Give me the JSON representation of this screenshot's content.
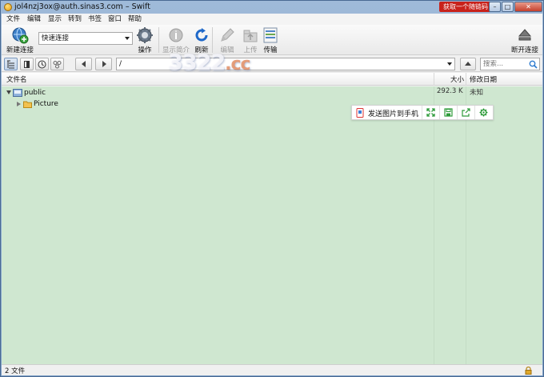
{
  "window": {
    "title": "jol4nzj3ox@auth.sinas3.com – Swift",
    "promo_badge": "获取一个随链码！",
    "controls": {
      "minimize": "–",
      "maximize": "□",
      "close": "✕"
    }
  },
  "menu": [
    "文件",
    "编辑",
    "显示",
    "转到",
    "书签",
    "窗口",
    "帮助"
  ],
  "toolbar": {
    "new_connection": "新建连接",
    "quick_connect_value": "快速连接",
    "action": "操作",
    "info": "显示简介",
    "refresh": "刷新",
    "edit": "编辑",
    "upload": "上传",
    "transfers": "传输",
    "disconnect": "断开连接"
  },
  "pathbar": {
    "path_value": "/",
    "search_placeholder": "搜索..."
  },
  "columns": {
    "filename": "文件名",
    "size": "大小",
    "modified": "修改日期"
  },
  "files": [
    {
      "name": "public",
      "expanded": true,
      "size": "292.3 K",
      "modified": "未知"
    },
    {
      "name": "Picture",
      "expanded": false,
      "size": "",
      "modified": ""
    }
  ],
  "float_toolbar": {
    "send_to_phone": "发送图片到手机"
  },
  "watermark": {
    "main": "3322",
    "suffix": ".cc"
  },
  "status": {
    "count_text": "2 文件"
  },
  "colors": {
    "browser_bg": "#cfe7d0",
    "accent_green": "#2e9b3a",
    "title_bar": "#9fbad9",
    "promo_red": "#c8221b"
  }
}
